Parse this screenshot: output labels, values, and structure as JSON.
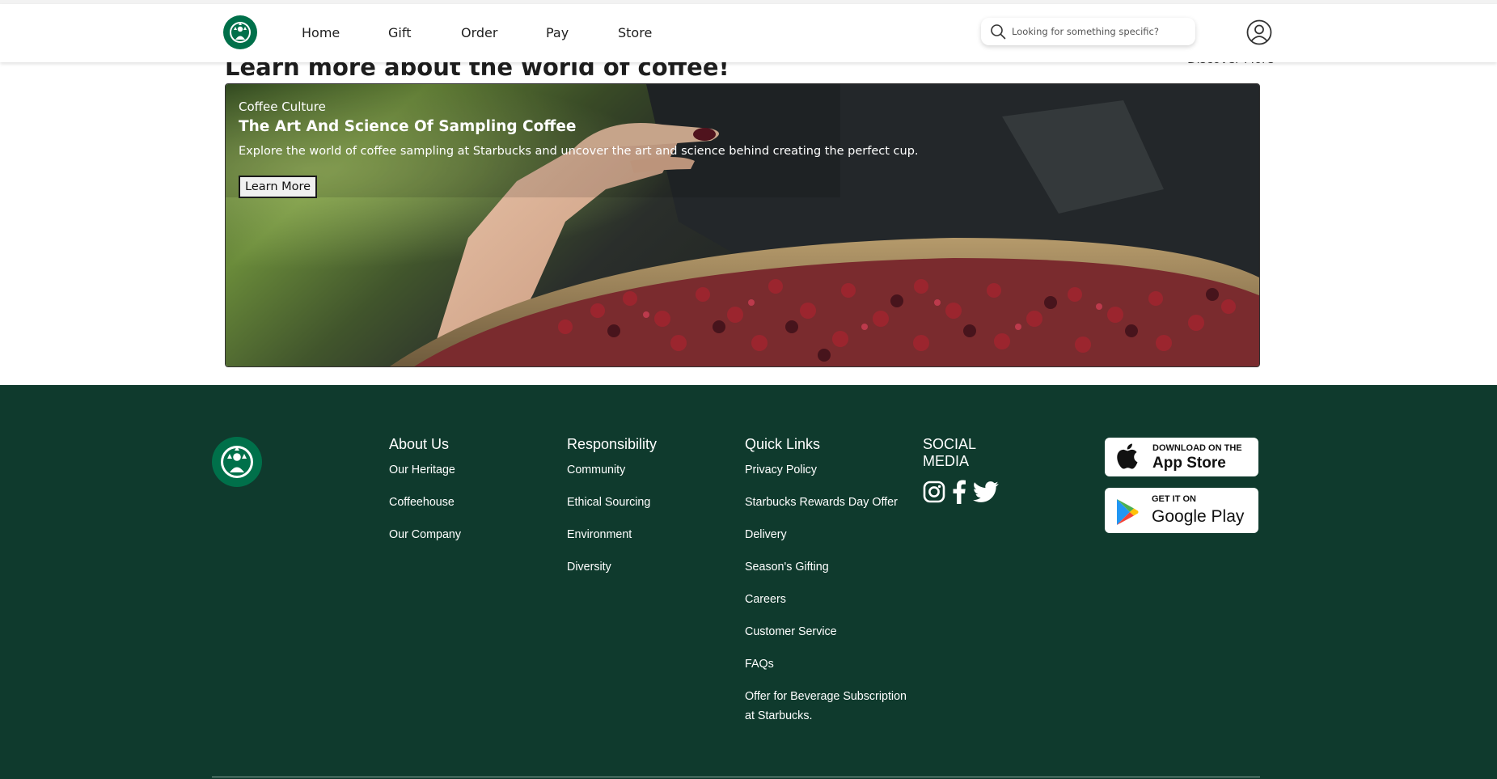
{
  "nav": {
    "links": [
      "Home",
      "Gift",
      "Order",
      "Pay",
      "Store"
    ],
    "search_placeholder": "Looking for something specific?"
  },
  "section": {
    "title": "Learn more about the world of coffee!",
    "discover_label": "Discover More"
  },
  "hero": {
    "kicker": "Coffee Culture",
    "title": "The Art And Science Of Sampling Coffee",
    "description": "Explore the world of coffee sampling at Starbucks and uncover the art and science behind creating the perfect cup.",
    "button_label": "Learn More"
  },
  "footer": {
    "about": {
      "heading": "About Us",
      "items": [
        "Our Heritage",
        "Coffeehouse",
        "Our Company"
      ]
    },
    "responsibility": {
      "heading": "Responsibility",
      "items": [
        "Community",
        "Ethical Sourcing",
        "Environment",
        "Diversity"
      ]
    },
    "quick_links": {
      "heading": "Quick Links",
      "items": [
        "Privacy Policy",
        "Starbucks Rewards Day Offer",
        "Delivery",
        "Season's Gifting",
        "Careers",
        "Customer Service",
        "FAQs",
        "Offer for Beverage Subscription at Starbucks."
      ]
    },
    "social": {
      "heading": "SOCIAL MEDIA",
      "icons": [
        "instagram-icon",
        "facebook-icon",
        "twitter-icon"
      ]
    },
    "app_store": {
      "small": "DOWNLOAD ON THE",
      "big": "App Store"
    },
    "google_play": {
      "small": "GET IT ON",
      "big": "Google Play"
    }
  },
  "colors": {
    "footer_bg": "#0f3a2d",
    "brand_green": "#00704a"
  }
}
